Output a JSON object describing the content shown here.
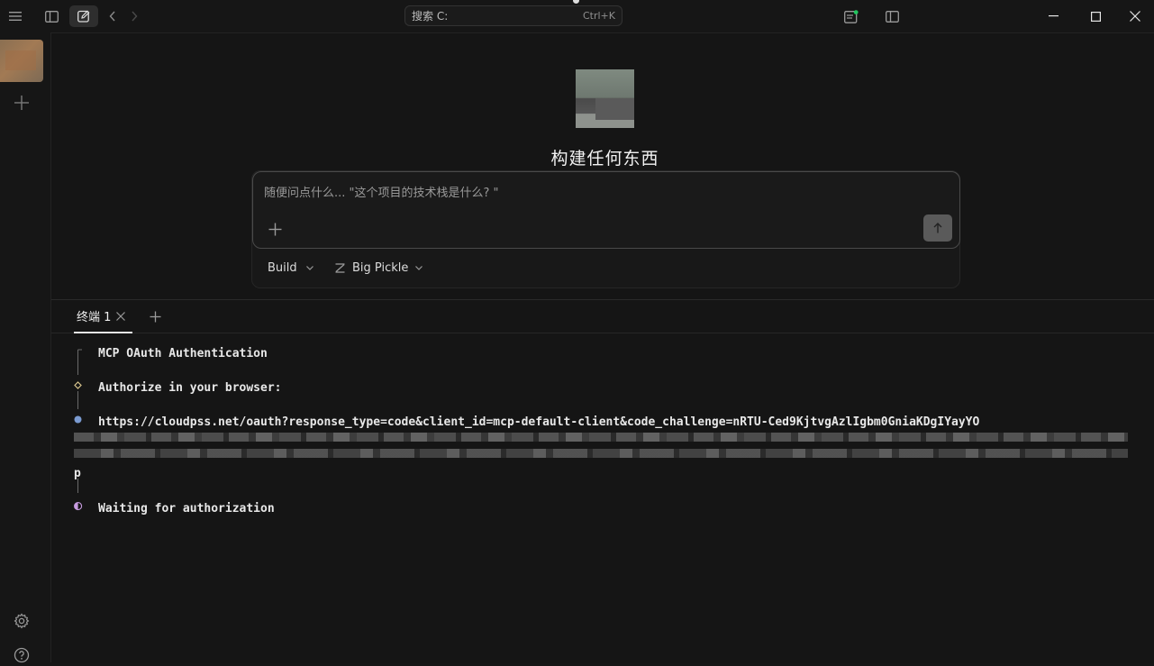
{
  "titlebar": {
    "search_placeholder": "搜索 C:",
    "search_shortcut": "Ctrl+K"
  },
  "main": {
    "hero_title": "构建任何东西",
    "composer": {
      "placeholder": "随便问点什么... \"这个项目的技术栈是什么? \""
    },
    "mode_label": "Build",
    "model_label": "Big Pickle"
  },
  "terminal": {
    "tab_label": "终端 1",
    "lines": {
      "title": "MCP OAuth Authentication",
      "authorize": "Authorize in your browser:",
      "url": "https://cloudpss.net/oauth?response_type=code&client_id=mcp-default-client&code_challenge=nRTU-Ced9KjtvgAzlIgbm0GniaKDgIYayYO",
      "url_tail": "p",
      "waiting": "Waiting for authorization"
    }
  },
  "colors": {
    "background": "#161616",
    "accent_dot": "#7b9bd1",
    "status_dot_green": "#22c55e",
    "diamond": "#d7c48c",
    "spinner": "#c79be0"
  },
  "icons": {
    "menu": "hamburger-icon",
    "sidebar_toggle": "sidebar-panel-icon",
    "new_session": "edit-square-icon",
    "back": "chevron-left-icon",
    "forward": "chevron-right-icon",
    "review": "review-panel-icon",
    "right_panel": "right-panel-icon",
    "minimize": "minimize-icon",
    "maximize": "maximize-icon",
    "close": "close-icon",
    "add_project": "plus-icon",
    "settings": "gear-icon",
    "help": "help-circle-icon",
    "attach": "plus-icon",
    "send": "arrow-up-icon",
    "model": "model-icon"
  }
}
